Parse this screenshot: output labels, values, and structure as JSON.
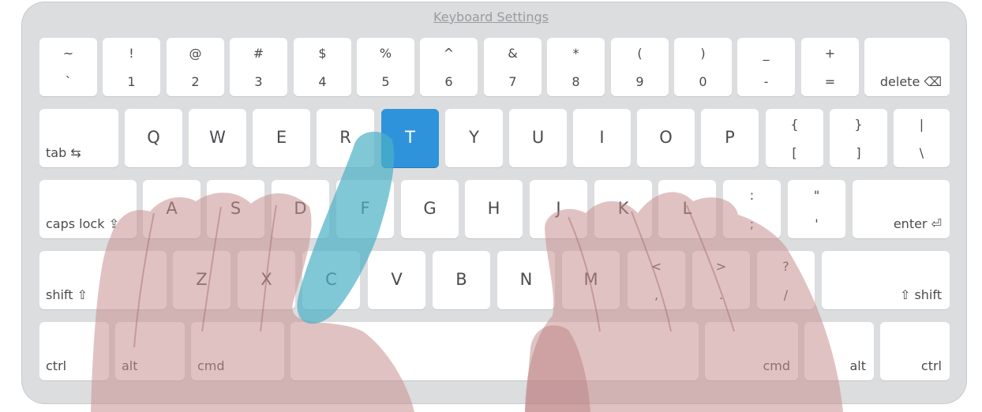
{
  "title": "Keyboard Settings",
  "keys": {
    "tilde": {
      "top": "~",
      "bottom": "`"
    },
    "k1": {
      "top": "!",
      "bottom": "1"
    },
    "k2": {
      "top": "@",
      "bottom": "2"
    },
    "k3": {
      "top": "#",
      "bottom": "3"
    },
    "k4": {
      "top": "$",
      "bottom": "4"
    },
    "k5": {
      "top": "%",
      "bottom": "5"
    },
    "k6": {
      "top": "^",
      "bottom": "6"
    },
    "k7": {
      "top": "&",
      "bottom": "7"
    },
    "k8": {
      "top": "*",
      "bottom": "8"
    },
    "k9": {
      "top": "(",
      "bottom": "9"
    },
    "k0": {
      "top": ")",
      "bottom": "0"
    },
    "minus": {
      "top": "_",
      "bottom": "-"
    },
    "equals": {
      "top": "+",
      "bottom": "="
    },
    "delete": "delete ⌫",
    "tab": "tab ⇆",
    "q": "Q",
    "w": "W",
    "e": "E",
    "r": "R",
    "t": "T",
    "y": "Y",
    "u": "U",
    "i": "I",
    "o": "O",
    "p": "P",
    "lbracket": {
      "top": "{",
      "bottom": "["
    },
    "rbracket": {
      "top": "}",
      "bottom": "]"
    },
    "backslash": {
      "top": "|",
      "bottom": "\\"
    },
    "capslock": "caps lock ⇪",
    "a": "A",
    "s": "S",
    "d": "D",
    "f": "F",
    "g": "G",
    "h": "H",
    "j": "J",
    "k": "K",
    "l": "L",
    "semicolon": {
      "top": ":",
      "bottom": ";"
    },
    "quote": {
      "top": "\"",
      "bottom": "'"
    },
    "enter": "enter ⏎",
    "shift_left": "shift ⇧",
    "z": "Z",
    "x": "X",
    "c": "C",
    "v": "V",
    "b": "B",
    "n": "N",
    "m": "M",
    "comma": {
      "top": "<",
      "bottom": ","
    },
    "period": {
      "top": ">",
      "bottom": "."
    },
    "slash": {
      "top": "?",
      "bottom": "/"
    },
    "shift_right": "⇧ shift",
    "ctrl_left": "ctrl",
    "alt_left": "alt",
    "cmd_left": "cmd",
    "cmd_right": "cmd",
    "alt_right": "alt",
    "ctrl_right": "ctrl"
  },
  "active_key": "T",
  "colors": {
    "active_key": "#2f93dc",
    "hand": "#c98f8f",
    "finger_highlight": "#4ab0c4"
  }
}
